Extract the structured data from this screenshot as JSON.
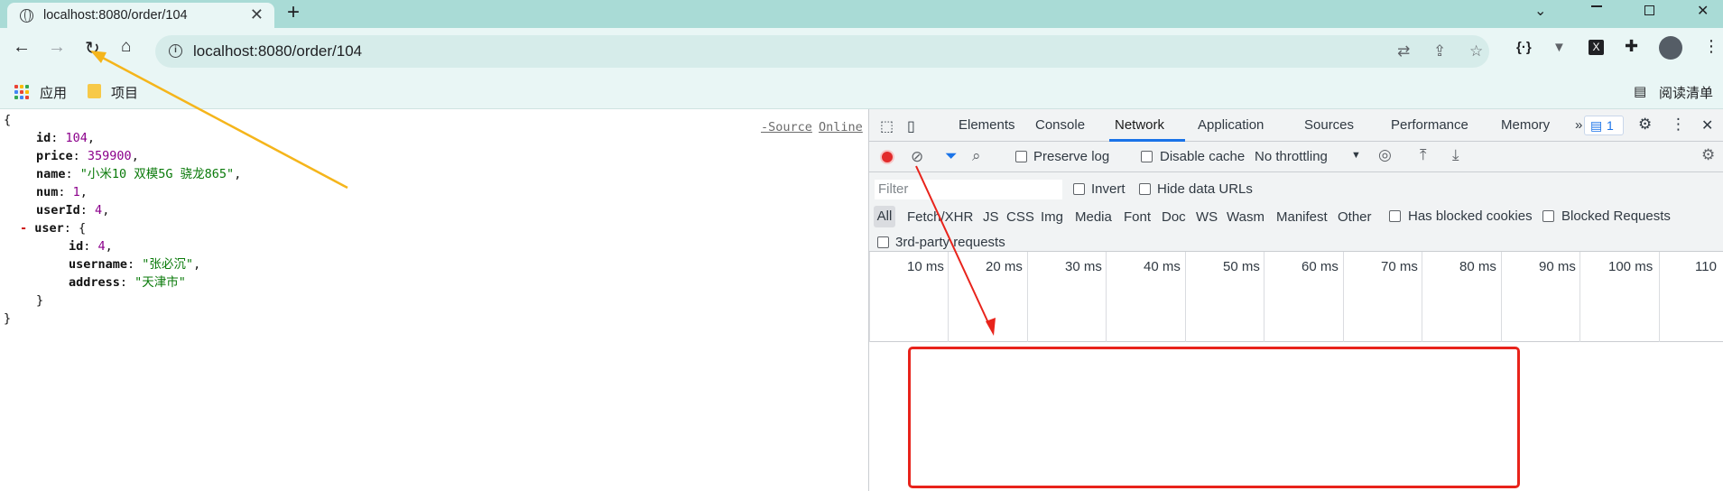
{
  "browser": {
    "tab_title": "localhost:8080/order/104",
    "url": "localhost:8080/order/104",
    "bookmarks": [
      {
        "label": "应用"
      },
      {
        "label": "项目"
      }
    ],
    "reading_list_label": "阅读清单"
  },
  "json_view": {
    "source_link": "-Source",
    "online_link": "Online",
    "open_brace": "{",
    "close_brace": "}",
    "user_close": "}",
    "collapse_marker": "-",
    "fields": {
      "id_key": "id",
      "id_val": "104",
      "price_key": "price",
      "price_val": "359900",
      "name_key": "name",
      "name_val": "\"小米10 双模5G 骁龙865\"",
      "num_key": "num",
      "num_val": "1",
      "userId_key": "userId",
      "userId_val": "4",
      "user_key": "user"
    },
    "user": {
      "id_key": "id",
      "id_val": "4",
      "username_key": "username",
      "username_val": "\"张必沉\"",
      "address_key": "address",
      "address_val": "\"天津市\""
    }
  },
  "devtools": {
    "tabs": [
      "Elements",
      "Console",
      "Network",
      "Application",
      "Sources",
      "Performance",
      "Memory"
    ],
    "active_tab": "Network",
    "more_tabs": "»",
    "issues_count": "1",
    "preserve_log": "Preserve log",
    "disable_cache": "Disable cache",
    "throttling": "No throttling",
    "filter_placeholder": "Filter",
    "invert": "Invert",
    "hide_data_urls": "Hide data URLs",
    "types": [
      "All",
      "Fetch/XHR",
      "JS",
      "CSS",
      "Img",
      "Media",
      "Font",
      "Doc",
      "WS",
      "Wasm",
      "Manifest",
      "Other"
    ],
    "has_blocked_cookies": "Has blocked cookies",
    "blocked_requests": "Blocked Requests",
    "third_party": "3rd-party requests",
    "timeline_ticks": [
      "10 ms",
      "20 ms",
      "30 ms",
      "40 ms",
      "50 ms",
      "60 ms",
      "70 ms",
      "80 ms",
      "90 ms",
      "100 ms",
      "110"
    ]
  },
  "annotations": {
    "arrow_colors": {
      "yellow": "#f5b51b",
      "red": "#e8231b"
    }
  }
}
